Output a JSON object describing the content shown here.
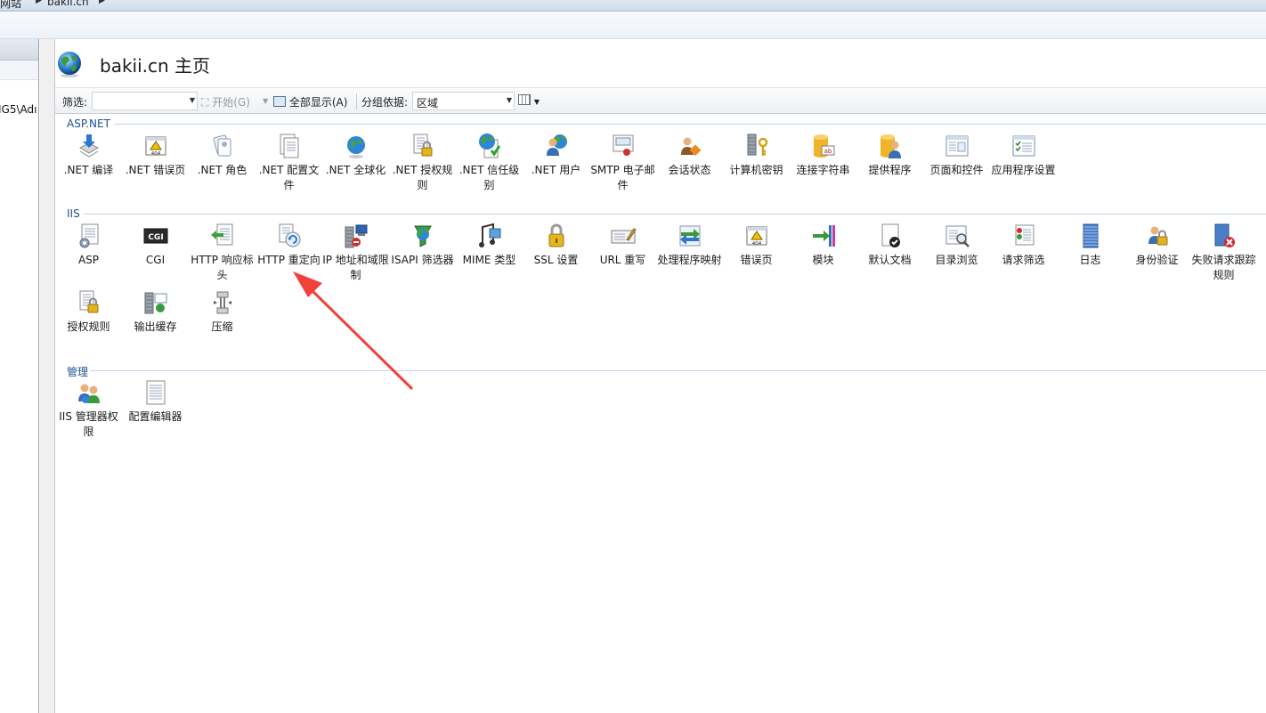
{
  "breadcrumb": {
    "items": [
      "网站",
      "bakii.cn"
    ]
  },
  "left_pane": {
    "node_text": "IG5\\Adı"
  },
  "header": {
    "title": "bakii.cn 主页"
  },
  "toolbar": {
    "filter_label": "筛选:",
    "filter_value": "",
    "go_label": "开始(G)",
    "show_all_label": "全部显示(A)",
    "group_by_label": "分组依据:",
    "group_by_value": "区域"
  },
  "sections": [
    {
      "title": "ASP.NET",
      "items": [
        {
          "label": ".NET 编译",
          "icon": "dotnet-compile-icon"
        },
        {
          "label": ".NET 错误页",
          "icon": "dotnet-error-page-icon"
        },
        {
          "label": ".NET 角色",
          "icon": "dotnet-roles-icon"
        },
        {
          "label": ".NET 配置文件",
          "icon": "dotnet-profile-icon"
        },
        {
          "label": ".NET 全球化",
          "icon": "dotnet-globalization-icon"
        },
        {
          "label": ".NET 授权规则",
          "icon": "dotnet-authorization-icon"
        },
        {
          "label": ".NET 信任级别",
          "icon": "dotnet-trust-level-icon"
        },
        {
          "label": ".NET 用户",
          "icon": "dotnet-users-icon"
        },
        {
          "label": "SMTP 电子邮件",
          "icon": "smtp-email-icon"
        },
        {
          "label": "会话状态",
          "icon": "session-state-icon"
        },
        {
          "label": "计算机密钥",
          "icon": "machine-key-icon"
        },
        {
          "label": "连接字符串",
          "icon": "connection-strings-icon"
        },
        {
          "label": "提供程序",
          "icon": "providers-icon"
        },
        {
          "label": "页面和控件",
          "icon": "pages-controls-icon"
        },
        {
          "label": "应用程序设置",
          "icon": "app-settings-icon"
        }
      ]
    },
    {
      "title": "IIS",
      "items": [
        {
          "label": "ASP",
          "icon": "asp-icon"
        },
        {
          "label": "CGI",
          "icon": "cgi-icon"
        },
        {
          "label": "HTTP 响应标头",
          "icon": "http-response-headers-icon"
        },
        {
          "label": "HTTP 重定向",
          "icon": "http-redirect-icon"
        },
        {
          "label": "IP 地址和域限制",
          "icon": "ip-domain-restrictions-icon"
        },
        {
          "label": "ISAPI 筛选器",
          "icon": "isapi-filters-icon"
        },
        {
          "label": "MIME 类型",
          "icon": "mime-types-icon"
        },
        {
          "label": "SSL 设置",
          "icon": "ssl-settings-icon"
        },
        {
          "label": "URL 重写",
          "icon": "url-rewrite-icon"
        },
        {
          "label": "处理程序映射",
          "icon": "handler-mappings-icon"
        },
        {
          "label": "错误页",
          "icon": "error-pages-icon"
        },
        {
          "label": "模块",
          "icon": "modules-icon"
        },
        {
          "label": "默认文档",
          "icon": "default-document-icon"
        },
        {
          "label": "目录浏览",
          "icon": "directory-browsing-icon"
        },
        {
          "label": "请求筛选",
          "icon": "request-filtering-icon"
        },
        {
          "label": "日志",
          "icon": "logging-icon"
        },
        {
          "label": "身份验证",
          "icon": "authentication-icon"
        },
        {
          "label": "失败请求跟踪规则",
          "icon": "failed-request-tracing-icon"
        },
        {
          "label": "授权规则",
          "icon": "authorization-rules-icon"
        },
        {
          "label": "输出缓存",
          "icon": "output-caching-icon"
        },
        {
          "label": "压缩",
          "icon": "compression-icon"
        }
      ]
    },
    {
      "title": "管理",
      "items": [
        {
          "label": "IIS 管理器权限",
          "icon": "iis-manager-permissions-icon"
        },
        {
          "label": "配置编辑器",
          "icon": "configuration-editor-icon"
        }
      ]
    }
  ],
  "colors": {
    "section_header": "#1d4f91",
    "annotation_arrow": "#f0413a"
  }
}
